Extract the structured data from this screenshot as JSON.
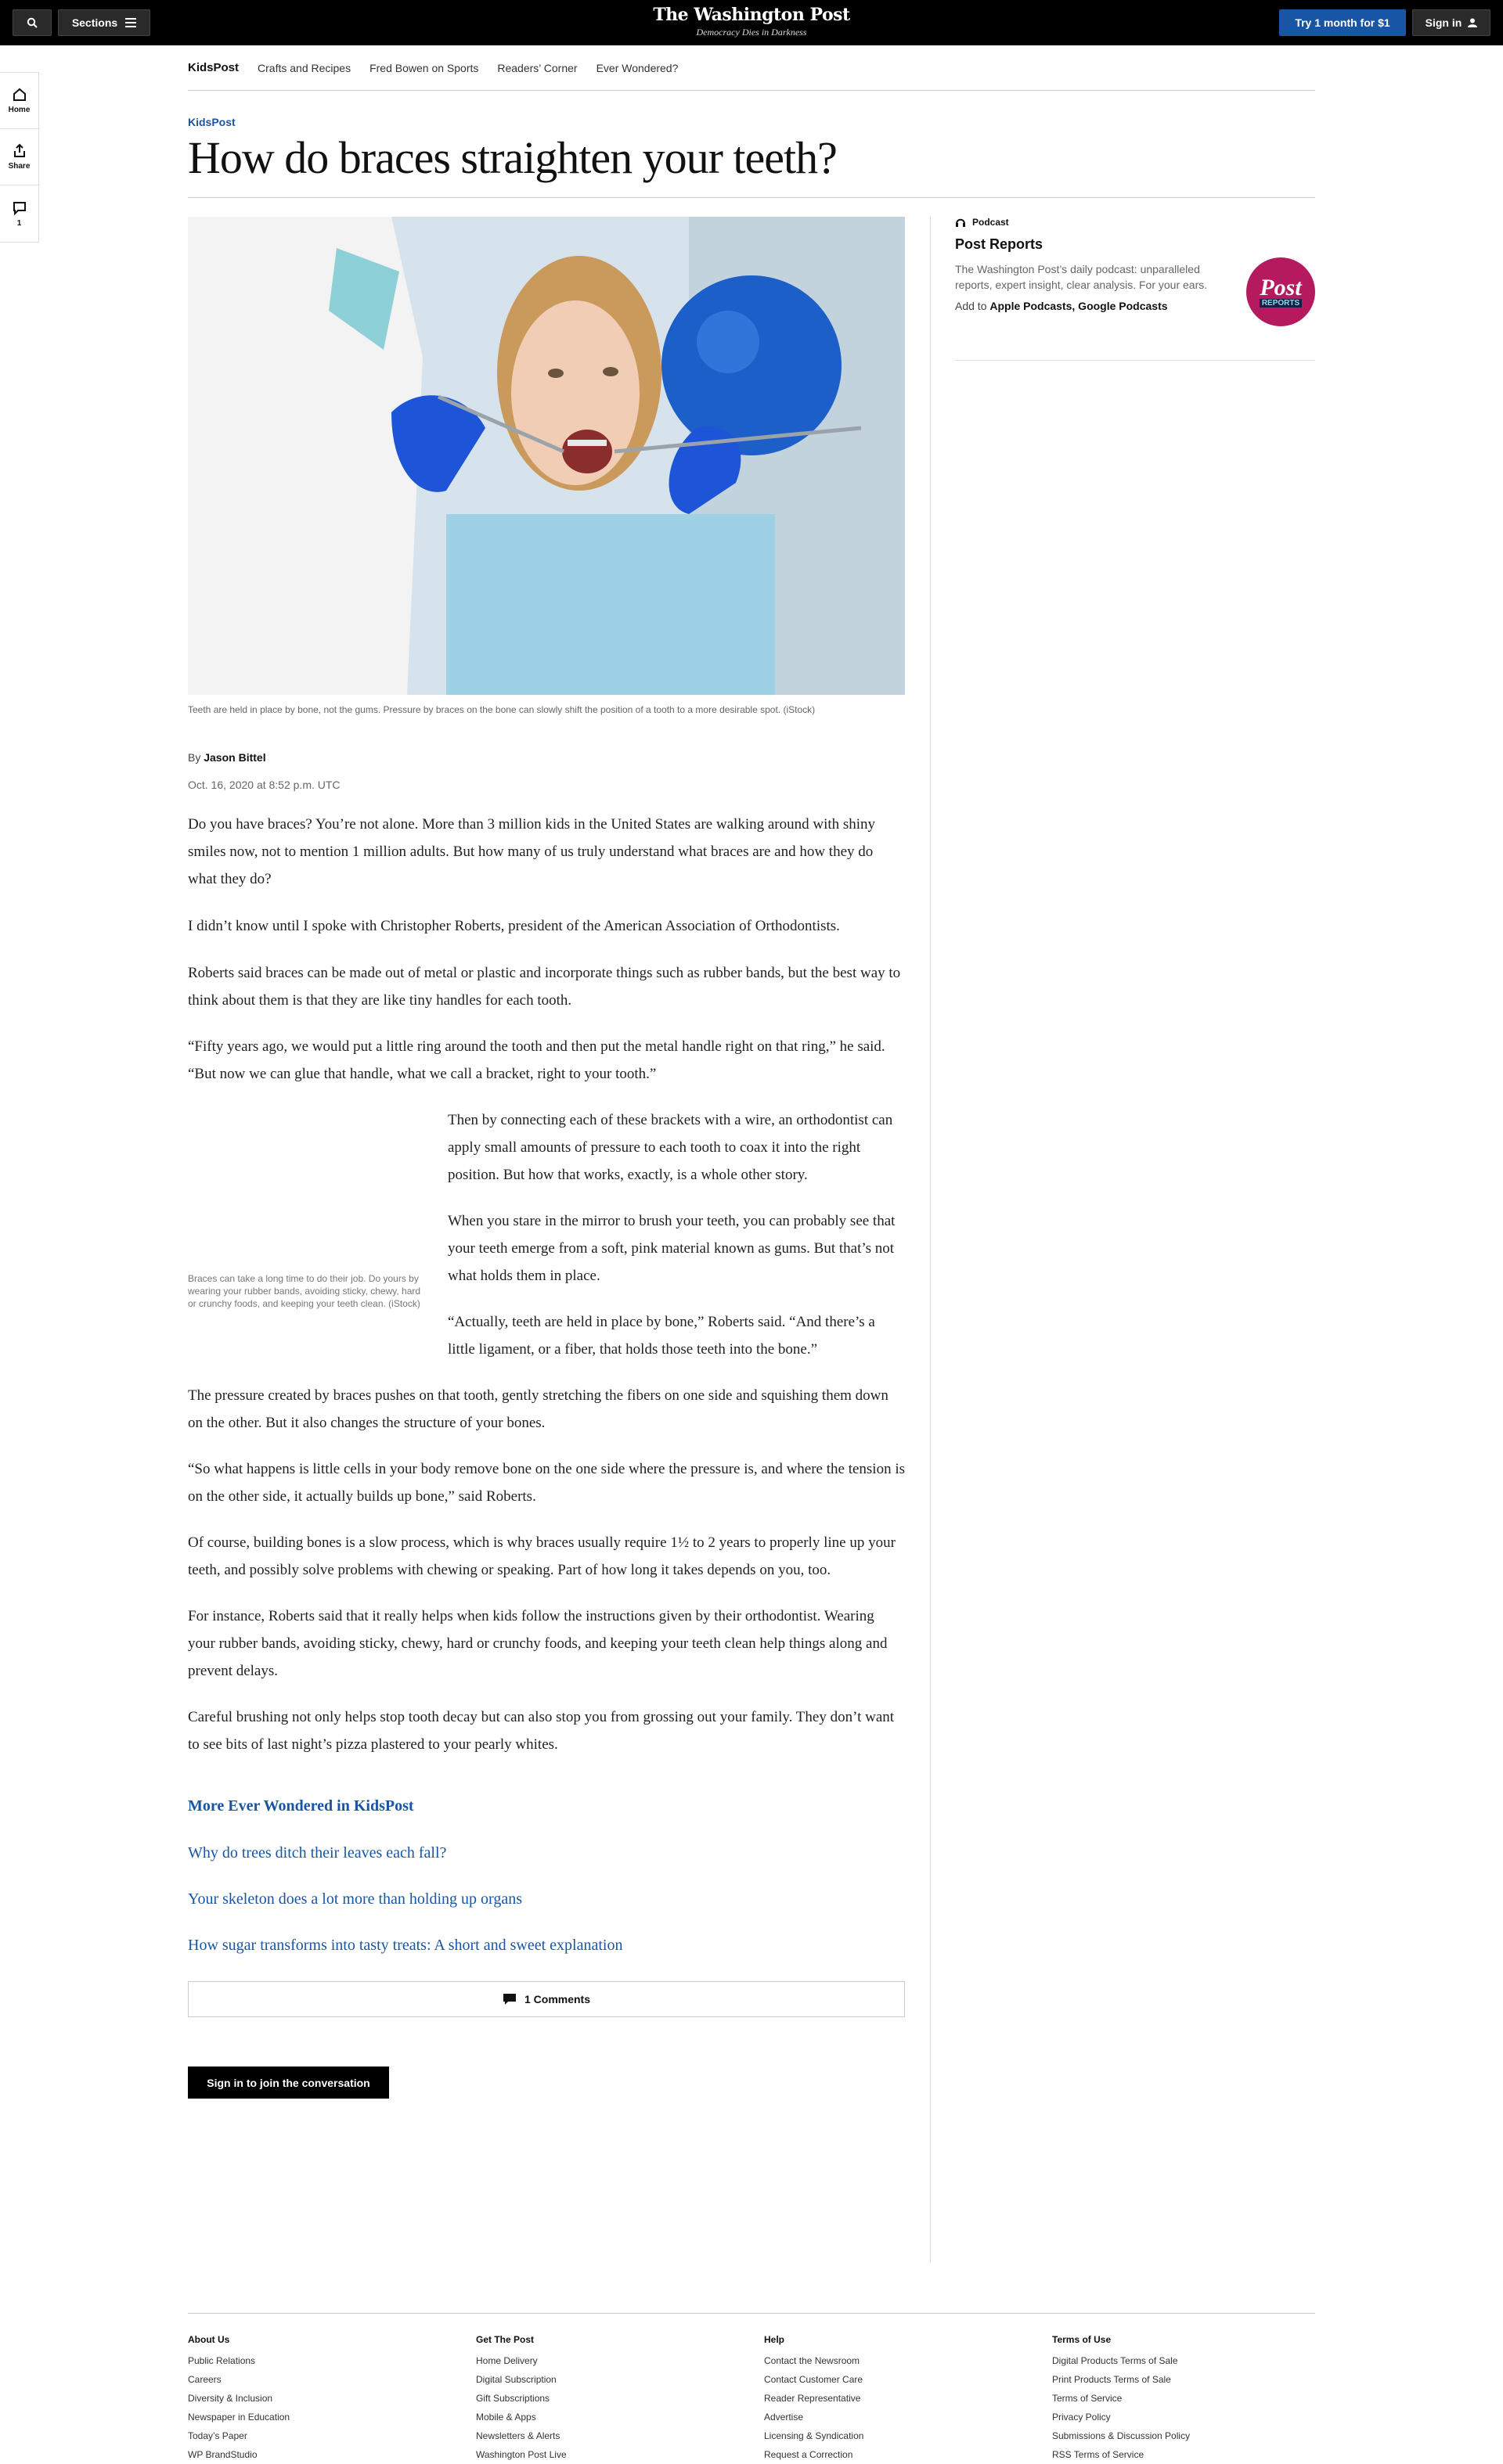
{
  "topbar": {
    "sections_label": "Sections",
    "logo_name": "The Washington Post",
    "logo_tagline": "Democracy Dies in Darkness",
    "try_label": "Try 1 month for $1",
    "signin_label": "Sign in"
  },
  "rail": {
    "home": "Home",
    "share": "Share",
    "comments_count": "1"
  },
  "subnav": [
    "KidsPost",
    "Crafts and Recipes",
    "Fred Bowen on Sports",
    "Readers’ Corner",
    "Ever Wondered?"
  ],
  "article": {
    "kicker": "KidsPost",
    "headline": "How do braces straighten your teeth?",
    "hero_caption": "Teeth are held in place by bone, not the gums. Pressure by braces on the bone can slowly shift the position of a tooth to a more desirable spot. (iStock)",
    "byline_prefix": "By",
    "author": "Jason Bittel",
    "date": "Oct. 16, 2020 at 8:52 p.m. UTC",
    "inline_caption": "Braces can take a long time to do their job. Do yours by wearing your rubber bands, avoiding sticky, chewy, hard or crunchy foods, and keeping your teeth clean. (iStock)",
    "paragraphs": [
      "Do you have braces? You’re not alone. More than 3 million kids in the United States are walking around with shiny smiles now, not to mention 1 million adults. But how many of us truly understand what braces are and how they do what they do?",
      "I didn’t know until I spoke with Christopher Roberts, president of the American Association of Orthodontists.",
      "Roberts said braces can be made out of metal or plastic and incorporate things such as rubber bands, but the best way to think about them is that they are like tiny handles for each tooth.",
      "“Fifty years ago, we would put a little ring around the tooth and then put the metal handle right on that ring,” he said. “But now we can glue that handle, what we call a bracket, right to your tooth.”",
      "Then by connecting each of these brackets with a wire, an orthodontist can apply small amounts of pressure to each tooth to coax it into the right position. But how that works, exactly, is a whole other story.",
      "When you stare in the mirror to brush your teeth, you can probably see that your teeth emerge from a soft, pink material known as gums. But that’s not what holds them in place.",
      "“Actually, teeth are held in place by bone,” Roberts said. “And there’s a little ligament, or a fiber, that holds those teeth into the bone.”",
      "The pressure created by braces pushes on that tooth, gently stretching the fibers on one side and squishing them down on the other. But it also changes the structure of your bones.",
      "“So what happens is little cells in your body remove bone on the one side where the pressure is, and where the tension is on the other side, it actually builds up bone,” said Roberts.",
      "Of course, building bones is a slow process, which is why braces usually require 1½ to 2 years to properly line up your teeth, and possibly solve problems with chewing or speaking. Part of how long it takes depends on you, too.",
      "For instance, Roberts said that it really helps when kids follow the instructions given by their orthodontist. Wearing your rubber bands, avoiding sticky, chewy, hard or crunchy foods, and keeping your teeth clean help things along and prevent delays.",
      "Careful brushing not only helps stop tooth decay but can also stop you from grossing out your family. They don’t want to see bits of last night’s pizza plastered to your pearly whites."
    ],
    "more_heading": "More Ever Wondered in KidsPost",
    "more_links": [
      "Why do trees ditch their leaves each fall?",
      "Your skeleton does a lot more than holding up organs",
      "How sugar transforms into tasty treats: A short and sweet explanation"
    ],
    "comments_label": "1 Comments",
    "join_label": "Sign in to join the conversation"
  },
  "podcast": {
    "label": "Podcast",
    "title": "Post Reports",
    "description": "The Washington Post’s daily podcast: unparalleled reports, expert insight, clear analysis. For your ears.",
    "add_prefix": "Add to",
    "add_links": "Apple Podcasts, Google Podcasts",
    "logo_word": "Post",
    "logo_sub": "REPORTS"
  },
  "footer": {
    "columns": [
      {
        "heading": "About Us",
        "items": [
          "Public Relations",
          "Careers",
          "Diversity & Inclusion",
          "Newspaper in Education",
          "Today’s Paper",
          "WP BrandStudio"
        ]
      },
      {
        "heading": "Get The Post",
        "items": [
          "Home Delivery",
          "Digital Subscription",
          "Gift Subscriptions",
          "Mobile & Apps",
          "Newsletters & Alerts",
          "Washington Post Live"
        ]
      },
      {
        "heading": "Help",
        "items": [
          "Contact the Newsroom",
          "Contact Customer Care",
          "Reader Representative",
          "Advertise",
          "Licensing & Syndication",
          "Request a Correction"
        ]
      },
      {
        "heading": "Terms of Use",
        "items": [
          "Digital Products Terms of Sale",
          "Print Products Terms of Sale",
          "Terms of Service",
          "Privacy Policy",
          "Submissions & Discussion Policy",
          "RSS Terms of Service"
        ]
      }
    ]
  },
  "colors": {
    "accent": "#1955a5",
    "podcast_logo": "#b5195e",
    "topbar": "#000000"
  }
}
